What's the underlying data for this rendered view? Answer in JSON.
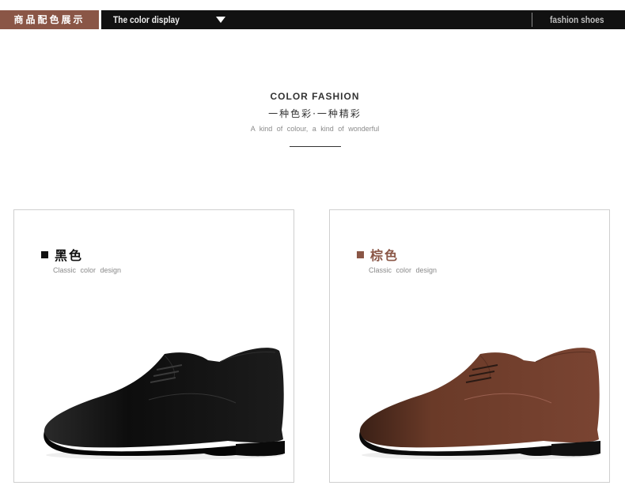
{
  "topbar": {
    "cn_label": "商品配色展示",
    "en_label": "The color display",
    "right_label": "fashion shoes"
  },
  "header": {
    "title": "COLOR FASHION",
    "cn_subtitle": "一种色彩·一种精彩",
    "en_subtitle": "A kind of colour, a kind of wonderful"
  },
  "cards": [
    {
      "name": "黑色",
      "subtitle": "Classic color design",
      "accent": "#111111",
      "icon": "black-leather-derby-shoe"
    },
    {
      "name": "棕色",
      "subtitle": "Classic color design",
      "accent": "#8a5646",
      "icon": "brown-leather-derby-shoe"
    }
  ]
}
